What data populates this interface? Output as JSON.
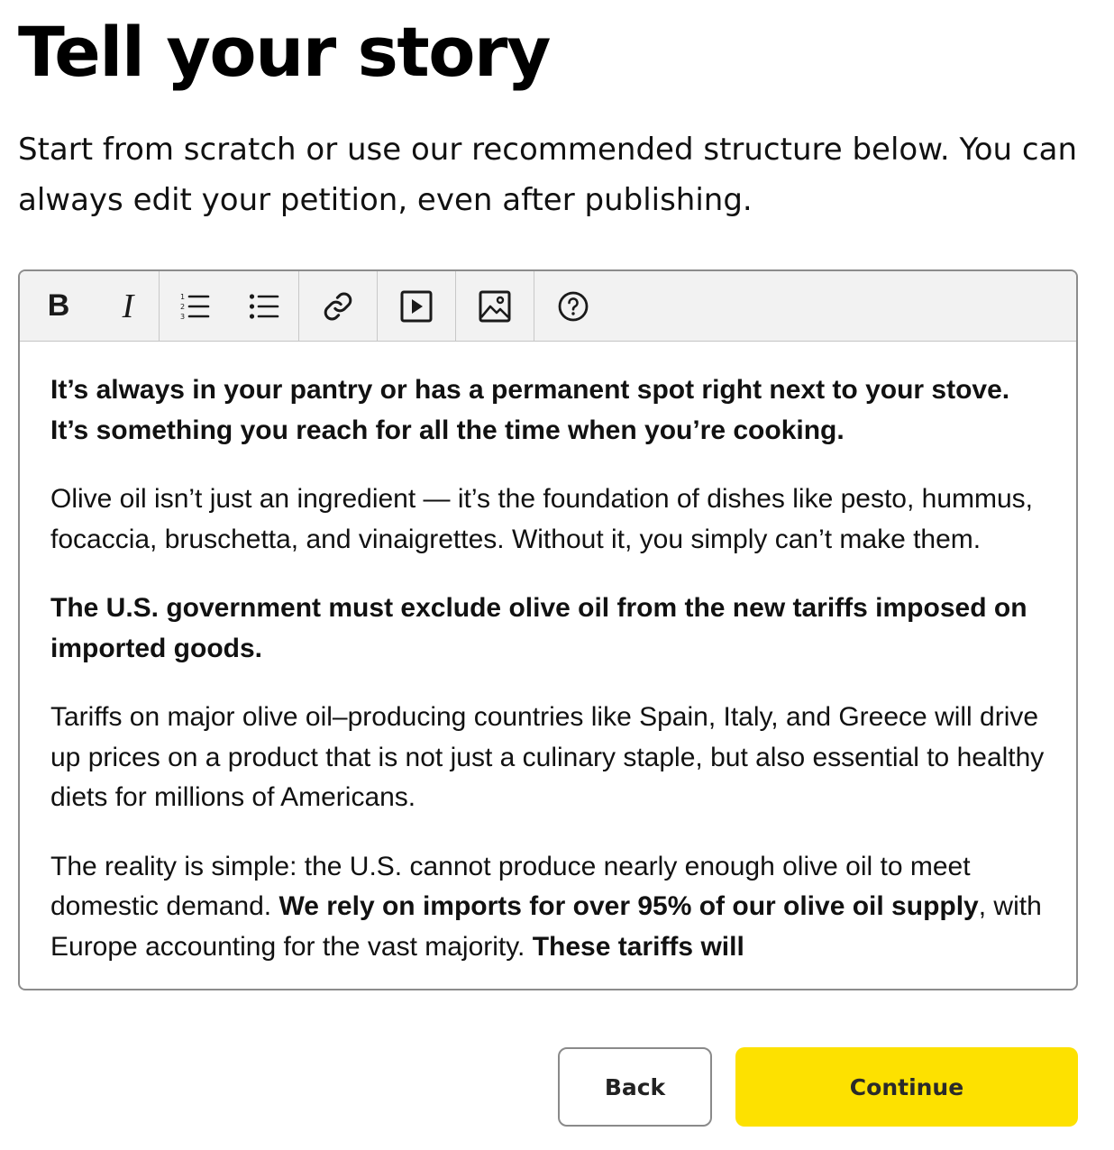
{
  "page": {
    "title": "Tell your story",
    "intro": "Start from scratch or use our recommended structure below. You can always edit your petition, even after publishing."
  },
  "toolbar": {
    "items": [
      {
        "icon": "bold-icon",
        "label": "B"
      },
      {
        "icon": "italic-icon",
        "label": "I"
      },
      {
        "icon": "numbered-list-icon"
      },
      {
        "icon": "bulleted-list-icon"
      },
      {
        "icon": "link-icon"
      },
      {
        "icon": "video-icon"
      },
      {
        "icon": "image-icon"
      },
      {
        "icon": "help-icon"
      }
    ]
  },
  "editor": {
    "p1": "It’s always in your pantry or has a permanent spot right next to your stove. It’s something you reach for all the time when you’re cooking.",
    "p2": "Olive oil isn’t just an ingredient — it’s the foundation of dishes like pesto, hummus, focaccia, bruschetta, and vinaigrettes. Without it, you simply can’t make them.",
    "p3": "The U.S. government must exclude olive oil from the new tariffs imposed on imported goods.",
    "p4": "Tariffs on major olive oil–producing countries like Spain, Italy, and Greece will drive up prices on a product that is not just a culinary staple, but also essential to healthy diets for millions of Americans.",
    "p5_a": "The reality is simple: the U.S. cannot produce nearly enough olive oil to meet domestic demand. ",
    "p5_b": "We rely on imports for over 95% of our olive oil supply",
    "p5_c": ", with Europe accounting for the vast majority. ",
    "p5_d": "These tariffs will"
  },
  "actions": {
    "back_label": "Back",
    "continue_label": "Continue"
  },
  "colors": {
    "continue_bg": "#fde100",
    "toolbar_bg": "#f2f2f2",
    "border": "#8c8c8c"
  }
}
